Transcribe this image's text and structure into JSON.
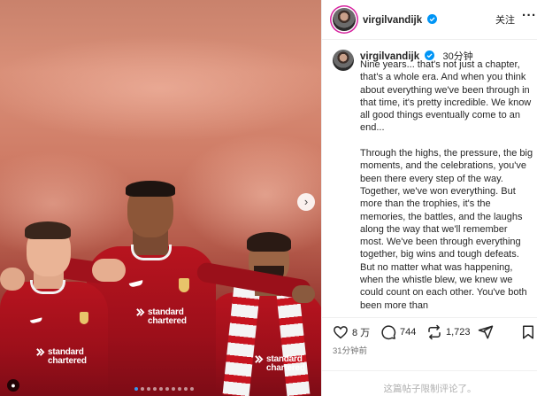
{
  "post": {
    "username": "virgilvandijk",
    "verified": true,
    "follow_label": "关注",
    "more_label": "···",
    "time_ago": "30分钟",
    "caption_paragraphs": [
      "Nine years... that's not just a chapter, that's a whole era. And when you think about everything we've been through in that time, it's pretty incredible. We know all good things eventually come to an end...",
      "Through the highs, the pressure, the big moments, and the celebrations, you've been there every step of the way. Together, we've won everything. But more than the trophies, it's the memories, the battles, and the laughs along the way that we'll remember most. We've been through everything together, big wins and tough defeats. But no matter what was happening, when the whistle blew, we knew we could count on each other. You've both been more than"
    ],
    "likes": "8 万",
    "comments": "744",
    "reposts": "1,723",
    "posted_ago": "31分钟前",
    "comments_disabled": "这篇帖子限制评论了。"
  },
  "photo": {
    "sponsor_text_line1": "standard",
    "sponsor_text_line2": "chartered",
    "carousel_dot_count": 10,
    "carousel_active_index": 0
  },
  "icons": {
    "like": "heart-icon",
    "comment": "comment-icon",
    "repost": "repost-icon",
    "share": "send-icon",
    "save": "bookmark-icon",
    "next": "chevron-right-icon",
    "verified": "verified-badge-icon",
    "tag": "person-tag-icon"
  },
  "colors": {
    "verified_blue": "#0095f6",
    "shirt_red": "#b8141f",
    "carousel_active": "#3897f0"
  }
}
